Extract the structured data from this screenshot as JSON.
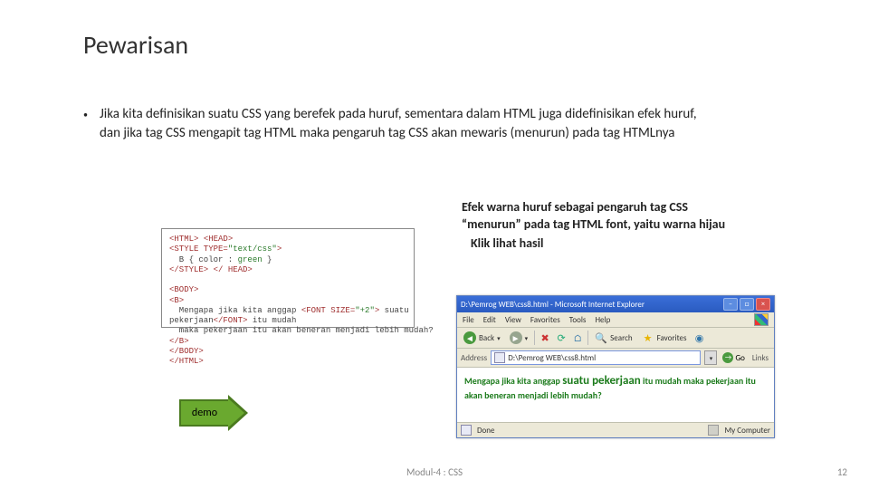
{
  "title": "Pewarisan",
  "bullet": "Jika kita definisikan suatu CSS yang berefek pada huruf, sementara dalam HTML juga didefinisikan efek huruf, dan jika tag CSS mengapit tag HTML maka pengaruh tag CSS akan mewaris (menurun) pada tag HTMLnya",
  "code": {
    "l1a": "<HTML>",
    "l1b": "<HEAD>",
    "l2a": "<STYLE TYPE=",
    "l2b": "\"text/css\"",
    "l2c": ">",
    "l3a": "  B { color : ",
    "l3b": "green",
    "l3c": " }",
    "l4a": "</STYLE>",
    "l4b": "</ HEAD>",
    "l5": "",
    "l6": "<BODY>",
    "l7": "<B>",
    "l8a": "  Mengapa jika kita anggap ",
    "l8b": "<FONT SIZE=",
    "l8c": "\"+2\"",
    "l8d": ">",
    "l8e": " suatu",
    "l9a": "pekerjaan",
    "l9b": "</FONT>",
    "l9c": " itu mudah",
    "l10": "  maka pekerjaan itu akan beneran menjadi lebih mudah?",
    "l11": "</B>",
    "l12": "</BODY>",
    "l13": "</HTML>"
  },
  "caption_main": "Efek warna huruf sebagai pengaruh tag CSS “menurun” pada tag HTML font, yaitu warna hijau",
  "caption_call": "Klik lihat hasil",
  "demo_label": "demo",
  "ie": {
    "title": "D:\\Pemrog WEB\\css8.html - Microsoft Internet Explorer",
    "menu": {
      "file": "File",
      "edit": "Edit",
      "view": "View",
      "favorites": "Favorites",
      "tools": "Tools",
      "help": "Help"
    },
    "toolbar": {
      "back": "Back",
      "search": "Search",
      "favorites": "Favorites"
    },
    "address_label": "Address",
    "address_value": "D:\\Pemrog WEB\\css8.html",
    "go": "Go",
    "links": "Links",
    "content_pre": "Mengapa jika kita anggap ",
    "content_big": "suatu pekerjaan",
    "content_post": " itu mudah maka pekerjaan itu akan beneran menjadi lebih mudah?",
    "status_done": "Done",
    "status_zone": "My Computer"
  },
  "footer": {
    "center": "Modul-4 : CSS",
    "page": "12"
  }
}
